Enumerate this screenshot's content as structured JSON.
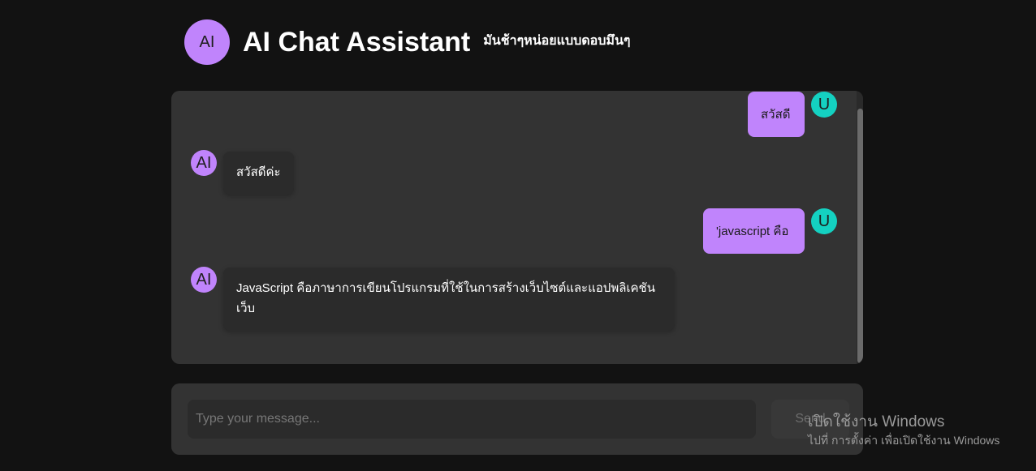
{
  "header": {
    "avatar_text": "AI",
    "title": "AI Chat Assistant",
    "subtitle": "มันช้าๆหน่อยแบบดอบมึนๆ"
  },
  "messages": [
    {
      "role": "user",
      "avatar": "U",
      "text": "สวัสดี"
    },
    {
      "role": "ai",
      "avatar": "AI",
      "text": "สวัสดีค่ะ"
    },
    {
      "role": "user",
      "avatar": "U",
      "text": "'javascript คือ"
    },
    {
      "role": "ai",
      "avatar": "AI",
      "text": "JavaScript คือภาษาการเขียนโปรแกรมที่ใช้ในการสร้างเว็บไซต์และแอปพลิเคชันเว็บ"
    }
  ],
  "composer": {
    "placeholder": "Type your message...",
    "send_label": "Send"
  },
  "watermark": {
    "title": "เปิดใช้งาน Windows",
    "subtitle": "ไปที่ การตั้งค่า เพื่อเปิดใช้งาน Windows"
  },
  "colors": {
    "background": "#121212",
    "panel": "#333333",
    "ai_accent": "#c084fc",
    "user_accent": "#14d1c1"
  }
}
